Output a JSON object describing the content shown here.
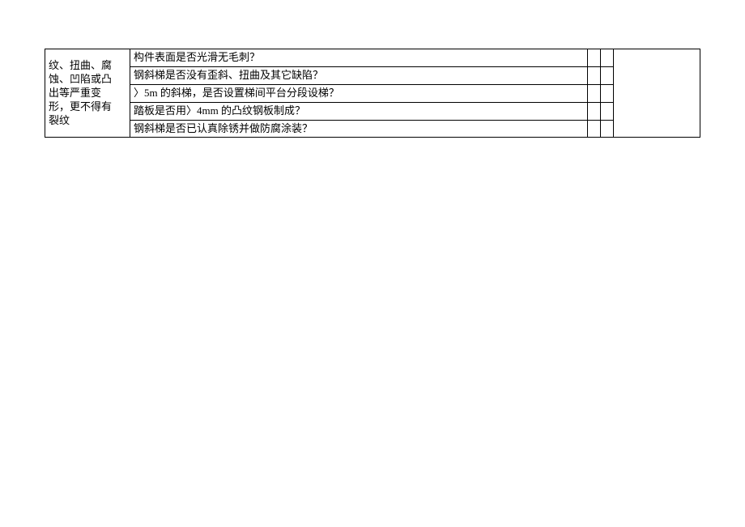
{
  "table": {
    "label_lines": [
      "纹、扭曲、腐",
      "蚀、凹陷或凸",
      "出等严重变",
      "形，更不得有",
      "裂纹"
    ],
    "rows": [
      {
        "question": "构件表面是否光滑无毛刺？"
      },
      {
        "question": "钢斜梯是否没有歪斜、扭曲及其它缺陷？"
      },
      {
        "question": "〉5m 的斜梯，是否设置梯间平台分段设梯？"
      },
      {
        "question": "踏板是否用〉4mm 的凸纹钢板制成？"
      },
      {
        "question": "钢斜梯是否已认真除锈并做防腐涂装？"
      }
    ]
  }
}
